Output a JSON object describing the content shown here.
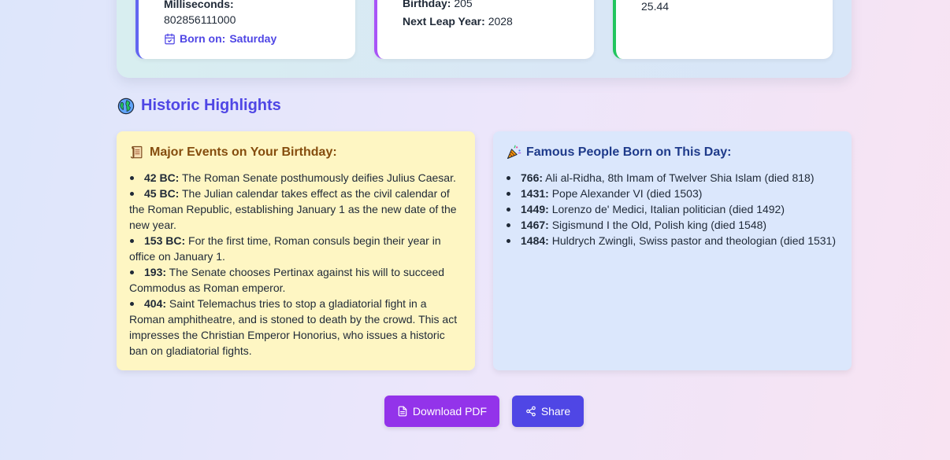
{
  "stats": {
    "card1": {
      "ms_label": "Milliseconds:",
      "ms_value": "802856111000",
      "born_label": "Born on:",
      "born_value": "Saturday"
    },
    "card2": {
      "birthday_label": "Birthday:",
      "birthday_value": "205",
      "leap_label": "Next Leap Year:",
      "leap_value": "2028"
    },
    "card3": {
      "value": "25.44"
    }
  },
  "highlights": {
    "title": "Historic Highlights",
    "title_icon": "globe-icon",
    "events": {
      "icon": "scroll-icon",
      "title": "Major Events on Your Birthday:",
      "items": [
        {
          "year": "42 BC:",
          "text": "The Roman Senate posthumously deifies Julius Caesar."
        },
        {
          "year": "45 BC:",
          "text": "The Julian calendar takes effect as the civil calendar of the Roman Republic, establishing January 1 as the new date of the new year."
        },
        {
          "year": "153 BC:",
          "text": "For the first time, Roman consuls begin their year in office on January 1."
        },
        {
          "year": "193:",
          "text": "The Senate chooses Pertinax against his will to succeed Commodus as Roman emperor."
        },
        {
          "year": "404:",
          "text": "Saint Telemachus tries to stop a gladiatorial fight in a Roman amphitheatre, and is stoned to death by the crowd. This act impresses the Christian Emperor Honorius, who issues a historic ban on gladiatorial fights."
        }
      ]
    },
    "people": {
      "icon": "party-popper-icon",
      "title": "Famous People Born on This Day:",
      "items": [
        {
          "year": "766:",
          "text": "Ali al-Ridha, 8th Imam of Twelver Shia Islam (died 818)"
        },
        {
          "year": "1431:",
          "text": "Pope Alexander VI (died 1503)"
        },
        {
          "year": "1449:",
          "text": "Lorenzo de' Medici, Italian politician (died 1492)"
        },
        {
          "year": "1467:",
          "text": "Sigismund I the Old, Polish king (died 1548)"
        },
        {
          "year": "1484:",
          "text": "Huldrych Zwingli, Swiss pastor and theologian (died 1531)"
        }
      ]
    }
  },
  "actions": {
    "download_label": "Download PDF",
    "share_label": "Share"
  },
  "colors": {
    "accent": "#4f46e5",
    "pdf_button": "#9333ea",
    "events_bg": "#fef6c3",
    "people_bg": "#dbe7fc"
  }
}
